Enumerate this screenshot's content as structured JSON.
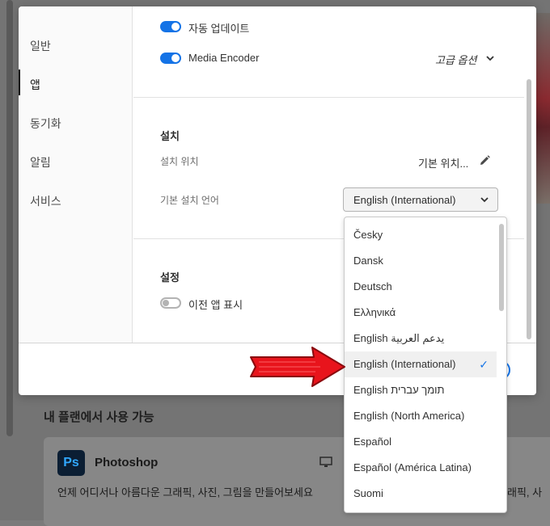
{
  "background": {
    "section_title": "내 플랜에서 사용 가능",
    "app_logo_text": "Ps",
    "app_name": "Photoshop",
    "app_description": "언제 어디서나 아름다운 그래픽, 사진, 그림을 만들어보세요",
    "right_description": "래픽, 사"
  },
  "sidebar": {
    "items": [
      {
        "label": "일반"
      },
      {
        "label": "앱"
      },
      {
        "label": "동기화"
      },
      {
        "label": "알림"
      },
      {
        "label": "서비스"
      }
    ],
    "active": "앱"
  },
  "updates": {
    "auto_update_label": "자동 업데이트",
    "auto_update_on": true,
    "media_encoder_label": "Media Encoder",
    "media_encoder_on": true,
    "advanced_options": "고급 옵션"
  },
  "install": {
    "heading": "설치",
    "location_label": "설치 위치",
    "location_value": "기본 위치...",
    "language_label": "기본 설치 언어",
    "language_value": "English (International)"
  },
  "settings": {
    "heading": "설정",
    "show_previous_label": "이전 앱 표시",
    "show_previous_on": false
  },
  "language_dropdown": {
    "options": [
      "Česky",
      "Dansk",
      "Deutsch",
      "Ελληνικά",
      "English يدعم العربية",
      "English (International)",
      "English תומך עברית",
      "English (North America)",
      "Español",
      "Español (América Latina)",
      "Suomi"
    ],
    "selected": "English (International)"
  },
  "colors": {
    "accent": "#1473e6",
    "annotation_arrow": "#e8141c"
  }
}
